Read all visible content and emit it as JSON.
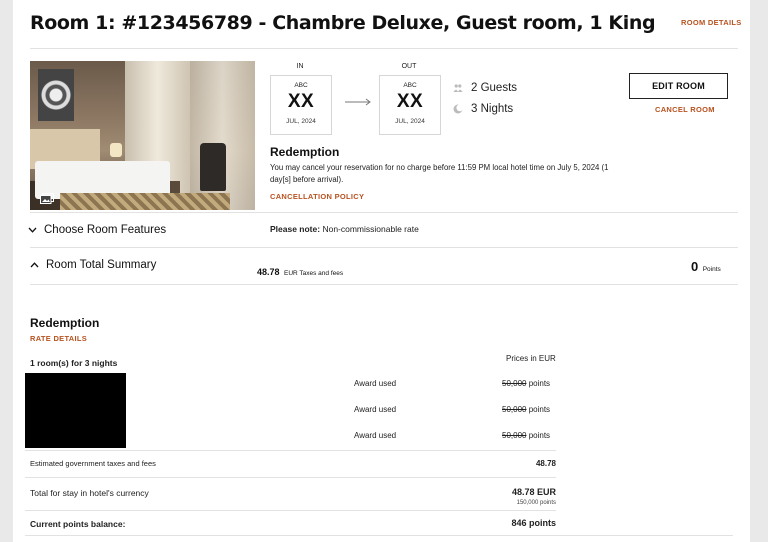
{
  "room": {
    "title": "Room 1: #123456789 - Chambre Deluxe, Guest room, 1 King",
    "details_link": "ROOM DETAILS"
  },
  "stay": {
    "in_label": "IN",
    "out_label": "OUT",
    "checkin": {
      "code": "ABC",
      "day": "XX",
      "month": "JUL, 2024"
    },
    "checkout": {
      "code": "ABC",
      "day": "XX",
      "month": "JUL, 2024"
    },
    "guests": "2 Guests",
    "nights": "3 Nights"
  },
  "actions": {
    "edit_room": "EDIT ROOM",
    "cancel_room": "CANCEL ROOM"
  },
  "redemption_notice": {
    "heading": "Redemption",
    "text": "You may cancel your reservation for no charge before 11:59 PM local hotel time on July 5, 2024 (1 day[s] before arrival).",
    "policy_link": "CANCELLATION POLICY"
  },
  "features": {
    "toggle_label": "Choose Room Features",
    "note_label": "Please note:",
    "note_text": "Non-commissionable rate"
  },
  "summary": {
    "toggle_label": "Room Total Summary",
    "amount": "48.78",
    "amount_suffix": "EUR Taxes and fees",
    "points": "0",
    "points_suffix": "Points"
  },
  "rate": {
    "heading": "Redemption",
    "details_link": "RATE DETAILS",
    "rooms_nights": "1 room(s) for 3 nights",
    "prices_in": "Prices in EUR",
    "nights": [
      {
        "label": "Award used",
        "value": "50,000",
        "unit": "points"
      },
      {
        "label": "Award used",
        "value": "50,000",
        "unit": "points"
      },
      {
        "label": "Award used",
        "value": "50,000",
        "unit": "points"
      }
    ],
    "taxes_label": "Estimated government taxes and fees",
    "taxes_value": "48.78",
    "total_label": "Total for stay in hotel's currency",
    "total_value": "48.78 EUR",
    "total_points": "150,000 points",
    "balance_label": "Current points balance:",
    "balance_value": "846 points"
  },
  "colors": {
    "accent": "#b8521f"
  }
}
